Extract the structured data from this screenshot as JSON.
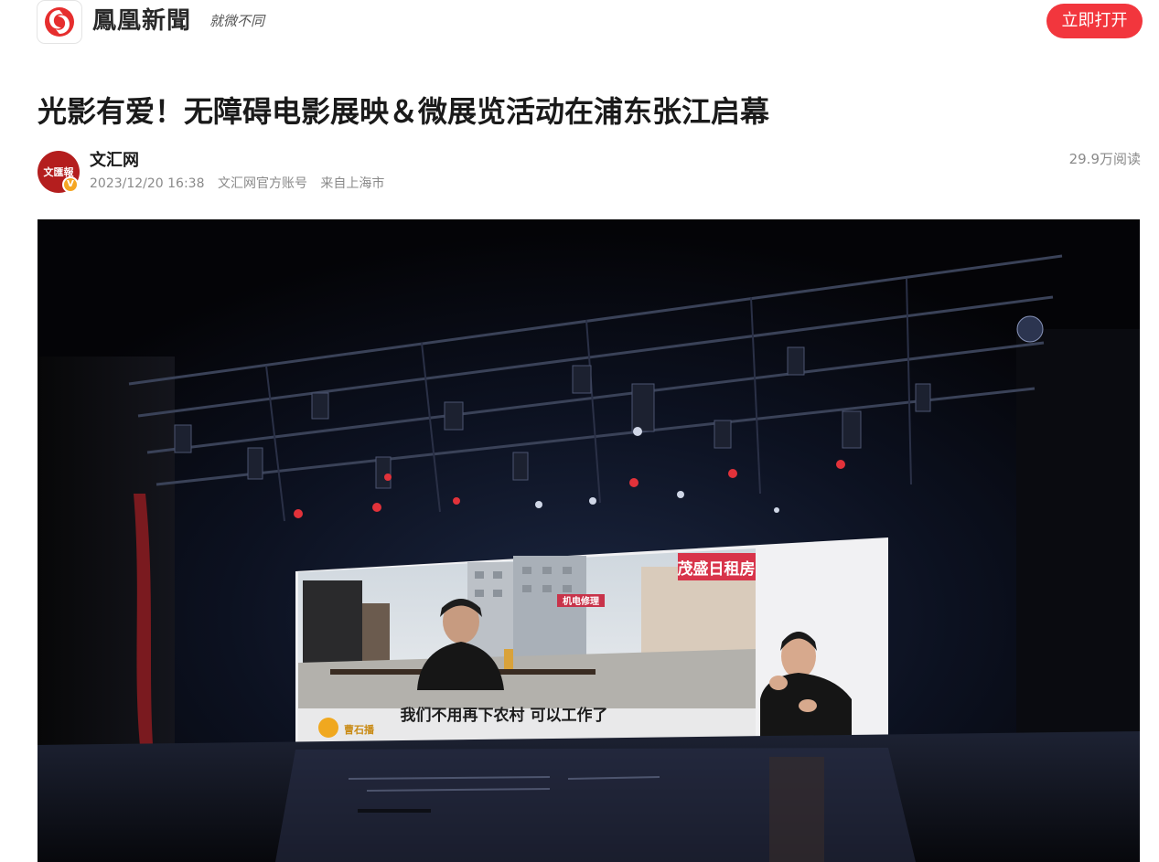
{
  "header": {
    "brand_name": "鳳凰新聞",
    "slogan": "就微不同",
    "open_app_label": "立即打开"
  },
  "article": {
    "title": "光影有爱！无障碍电影展映＆微展览活动在浦东张江启幕",
    "author": {
      "name": "文汇网",
      "avatar_text": "文匯報",
      "verified_mark": "V"
    },
    "meta": {
      "datetime": "2023/12/20 16:38",
      "account_type": "文汇网官方账号",
      "location": "来自上海市"
    },
    "read_count": "29.9万阅读"
  },
  "photo": {
    "subtitle": "我们不用再下农村 可以工作了",
    "shop_sign": "茂盛日租房",
    "repair_sign": "机电修理",
    "channel_logo": "曹石播"
  },
  "colors": {
    "accent_red": "#f2363d",
    "avatar_red": "#b41e1e",
    "badge_orange": "#f5a623",
    "meta_gray": "#8a8a8a"
  },
  "icons": {
    "logo": "phoenix-logo-icon",
    "verified": "verified-v-icon"
  }
}
